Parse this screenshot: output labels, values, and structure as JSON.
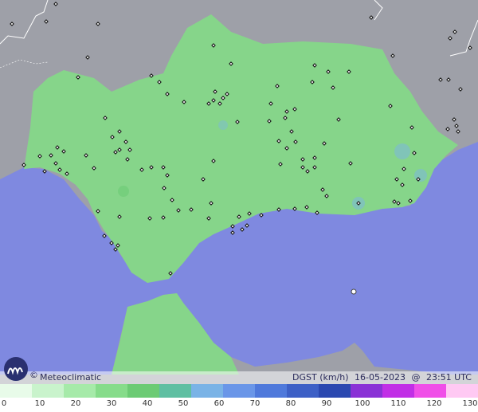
{
  "map": {
    "sea_color": "#7f89e0",
    "land_color": "#9ea0a8",
    "region_color": "#86d58a",
    "coast_line_color": "#ffffff"
  },
  "footer": {
    "brand": "Meteoclimatic",
    "variable": "DGST (km/h)",
    "date": "16-05-2023",
    "at": "@",
    "time": "23:51 UTC"
  },
  "legend": {
    "ticks": [
      "0",
      "10",
      "20",
      "30",
      "40",
      "50",
      "60",
      "70",
      "80",
      "90",
      "100",
      "110",
      "120",
      "130"
    ],
    "colors": [
      "#e8fbe9",
      "#c9f3cc",
      "#a6eaa9",
      "#86dc8a",
      "#6ccb74",
      "#5fbfa2",
      "#7ab3e6",
      "#6a96e8",
      "#4f79db",
      "#3d60c6",
      "#2b48b0",
      "#8a32d6",
      "#c12fe6",
      "#f04fe8",
      "#ffc9f3"
    ]
  }
}
